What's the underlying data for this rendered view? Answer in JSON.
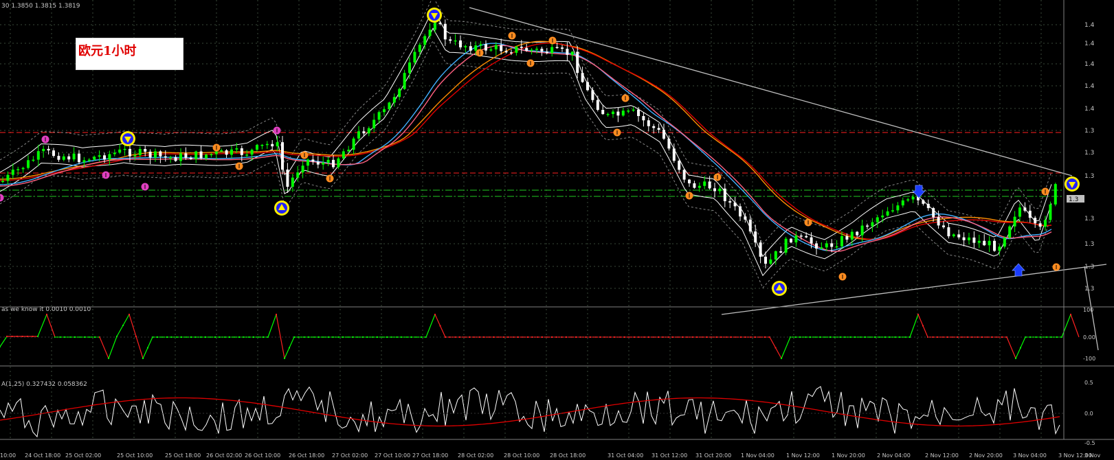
{
  "header": {
    "main_label": "30 1.3850 1.3815 1.3819",
    "title_box": "欧元1小时",
    "ind1_label": "as we know it 0.0010 0.0010",
    "ind2_label": "A(1,25) 0.327432 0.058362"
  },
  "colors": {
    "background": "#000000",
    "bull_candle": "#00ff00",
    "bear_candle": "#ffffff",
    "grid": "#3a4a3a",
    "red_level": "#ff2020",
    "green_level": "#22cc22",
    "trend_line": "#bfbfbf",
    "ma_orange": "#ff8c00",
    "ma_red": "#e00000",
    "ma_blue": "#40b0ff",
    "ma_pink": "#ff6080",
    "envelope": "#ffffff",
    "osc_up": "#00ff00",
    "osc_down": "#ff2020",
    "ind2_line": "#ffffff",
    "ind2_signal": "#e00000"
  },
  "chart_data": [
    {
      "type": "candlestick",
      "title": "欧元1小时",
      "price_labels": [
        "1.4",
        "1.4",
        "1.4",
        "1.4",
        "1.4",
        "1.3",
        "1.3",
        "1.3",
        "1.3",
        "1.3",
        "1.3",
        "1.3"
      ],
      "current_price_label": "1.3",
      "x_tick_labels": [
        "10:00",
        "24 Oct 18:00",
        "25 Oct 02:00",
        "25 Oct 10:00",
        "25 Oct 18:00",
        "26 Oct 02:00",
        "26 Oct 10:00",
        "26 Oct 18:00",
        "27 Oct 02:00",
        "27 Oct 10:00",
        "27 Oct 18:00",
        "28 Oct 02:00",
        "28 Oct 10:00",
        "28 Oct 18:00",
        "31 Oct 04:00",
        "31 Oct 12:00",
        "31 Oct 20:00",
        "1 Nov 04:00",
        "1 Nov 12:00",
        "1 Nov 20:00",
        "2 Nov 04:00",
        "2 Nov 12:00",
        "2 Nov 20:00",
        "3 Nov 04:00",
        "3 Nov 12:00",
        "3 Nov"
      ],
      "grid": true
    },
    {
      "type": "line",
      "title": "as we know it 0.0010 0.0010",
      "y_tick_labels": [
        "100",
        "0.00",
        "-100"
      ],
      "ylim": [
        -100,
        100
      ]
    },
    {
      "type": "line",
      "title": "A(1,25) 0.327432 0.058362",
      "y_tick_labels": [
        "0.5",
        "0.0",
        "-0.5"
      ],
      "ylim": [
        -0.5,
        0.5
      ]
    }
  ]
}
